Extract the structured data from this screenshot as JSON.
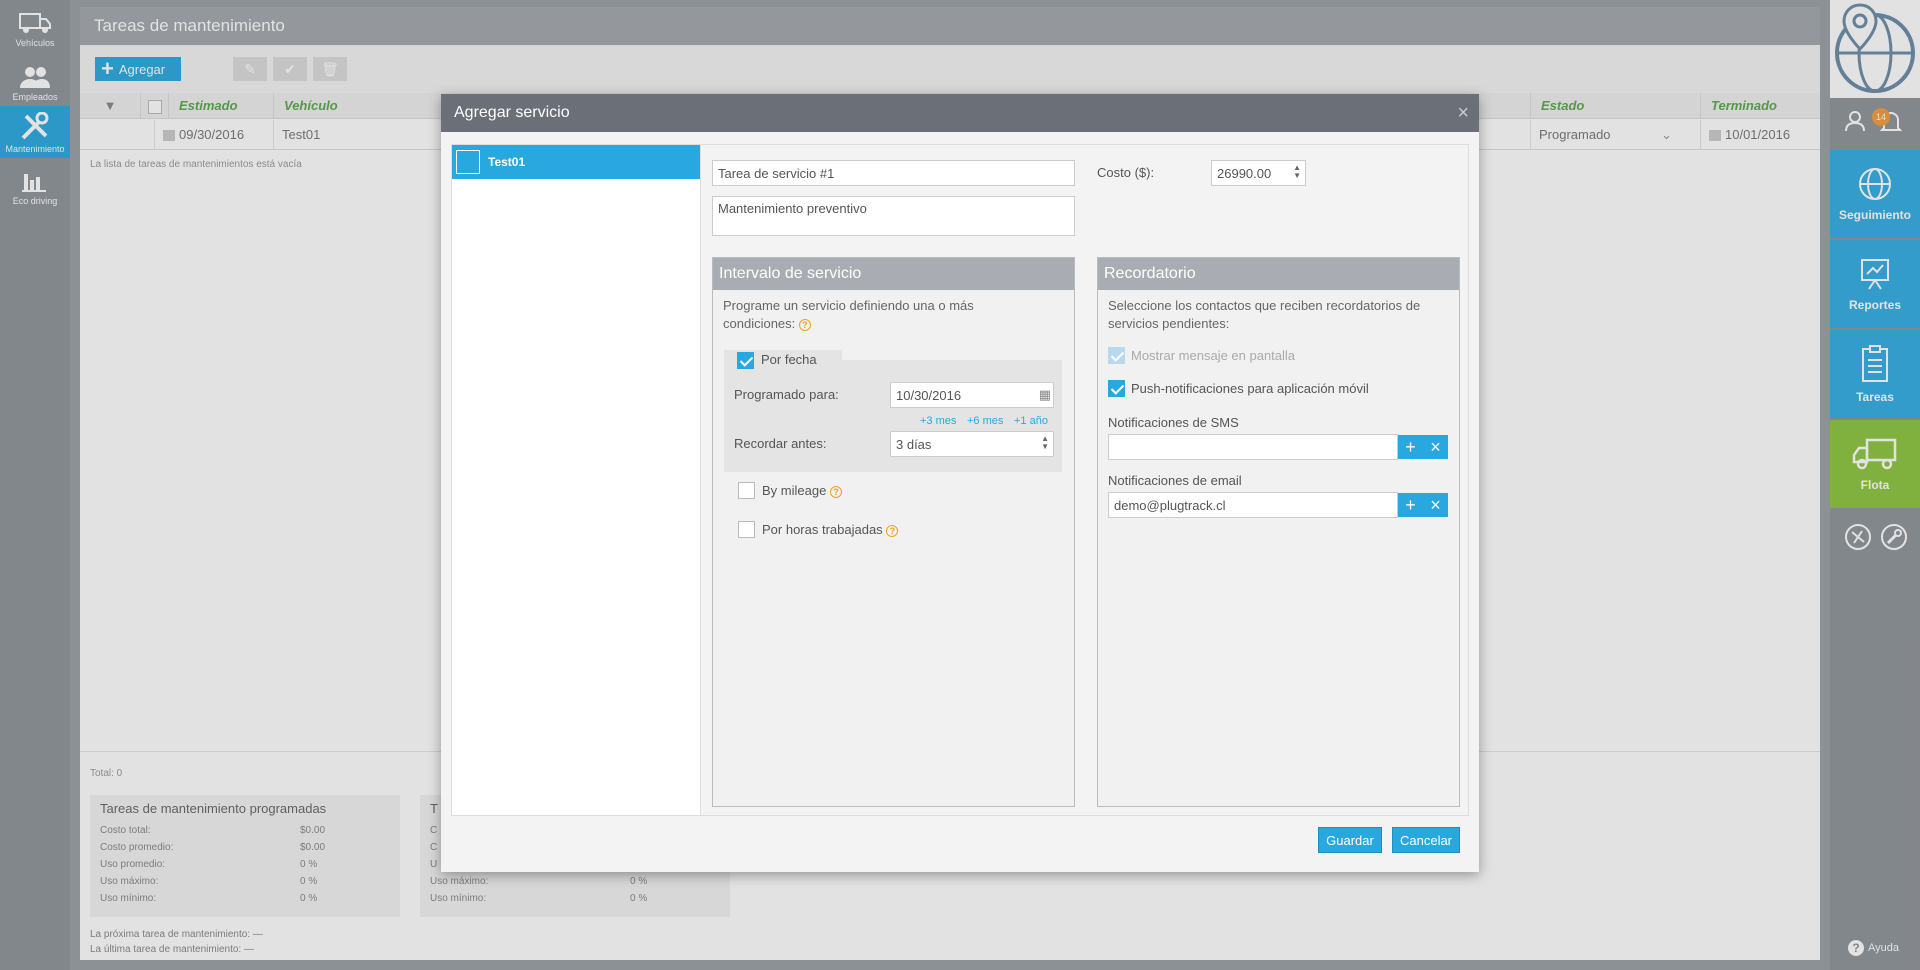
{
  "left_nav": [
    {
      "label": "Vehículos",
      "icon": "truck-icon"
    },
    {
      "label": "Empleados",
      "icon": "people-icon"
    },
    {
      "label": "Mantenimiento",
      "icon": "tools-icon",
      "active": true
    },
    {
      "label": "Eco driving",
      "icon": "bar-chart-icon"
    }
  ],
  "main": {
    "title": "Tareas de mantenimiento",
    "add_label": "Agregar",
    "columns": {
      "estimado": "Estimado",
      "vehiculo": "Vehículo",
      "estado": "Estado",
      "terminado": "Terminado"
    },
    "row": {
      "estimado": "09/30/2016",
      "vehiculo": "Test01",
      "estado": "Programado",
      "terminado": "10/01/2016"
    },
    "empty_message": "La lista de tareas de mantenimientos está vacía",
    "total": "Total: 0",
    "stats_title": "Tareas de mantenimiento programadas",
    "stats_title_partial": "T",
    "stats": [
      {
        "label": "Costo total:",
        "value": "$0.00"
      },
      {
        "label": "Costo promedio:",
        "value": "$0.00"
      },
      {
        "label": "Uso promedio:",
        "value": "0 %"
      },
      {
        "label": "Uso máximo:",
        "value": "0 %"
      },
      {
        "label": "Uso mínimo:",
        "value": "0 %"
      }
    ],
    "stats2_partial_labels": [
      "C",
      "C",
      "U",
      "Uso máximo:",
      "Uso mínimo:"
    ],
    "stats2_values": [
      "",
      "",
      "",
      "0 %",
      "0 %"
    ],
    "next_task": "La próxima tarea de mantenimiento: —",
    "last_task": "La última tarea de mantenimiento: —"
  },
  "right_nav": {
    "badge": "14",
    "items": [
      {
        "label": "Seguimiento",
        "icon": "globe-icon"
      },
      {
        "label": "Reportes",
        "icon": "presentation-icon"
      },
      {
        "label": "Tareas",
        "icon": "clipboard-icon"
      },
      {
        "label": "Flota",
        "icon": "truck-icon",
        "active": true
      }
    ],
    "help": "Ayuda"
  },
  "dialog": {
    "title": "Agregar servicio",
    "unit": "Test01",
    "service_name": "Tarea de servicio #1",
    "description": "Mantenimiento preventivo",
    "cost_label": "Costo ($):",
    "cost_value": "26990.00",
    "interval": {
      "title": "Intervalo de servicio",
      "desc": "Programe un servicio definiendo una o más condiciones:",
      "by_date": "Por fecha",
      "scheduled_label": "Programado para:",
      "scheduled_value": "10/30/2016",
      "links": [
        "+3 mes",
        "+6 mes",
        "+1 año"
      ],
      "remind_label": "Recordar antes:",
      "remind_value": "3  días",
      "by_mileage": "By mileage",
      "by_hours": "Por horas trabajadas"
    },
    "reminder": {
      "title": "Recordatorio",
      "desc": "Seleccione los contactos que reciben recordatorios de servicios pendientes:",
      "show_screen": "Mostrar mensaje en pantalla",
      "push": "Push-notificaciones para aplicación móvil",
      "sms_label": "Notificaciones de SMS",
      "sms_value": "",
      "email_label": "Notificaciones de email",
      "email_value": "demo@plugtrack.cl"
    },
    "save": "Guardar",
    "cancel": "Cancelar"
  }
}
